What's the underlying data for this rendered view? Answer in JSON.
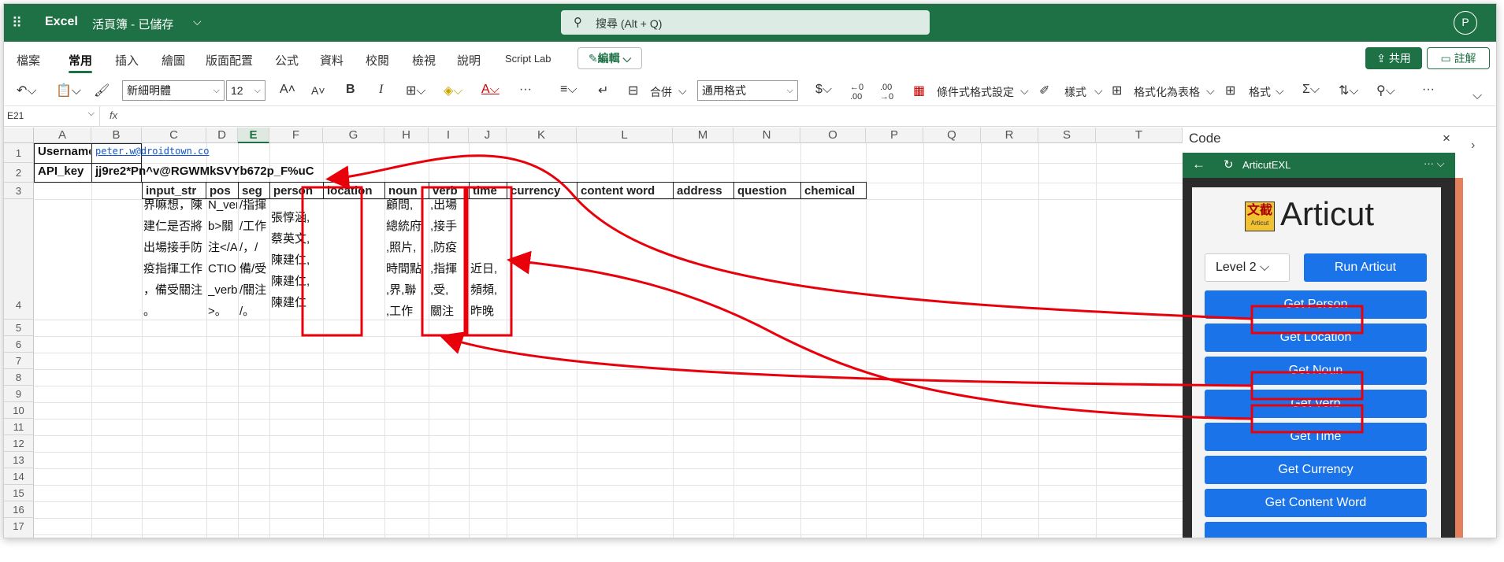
{
  "titlebar": {
    "app": "Excel",
    "doc": "活頁簿 - 已儲存",
    "search": "搜尋 (Alt + Q)",
    "avatar": "P"
  },
  "menus": [
    "檔案",
    "常用",
    "插入",
    "繪圖",
    "版面配置",
    "公式",
    "資料",
    "校閱",
    "檢視",
    "說明",
    "Script Lab"
  ],
  "edit_label": "編輯",
  "share_label": "共用",
  "comment_label": "註解",
  "ribbon": {
    "font": "新細明體",
    "size": "12",
    "format": "通用格式",
    "merge": "合併",
    "cond": "條件式格式設定",
    "styles": "樣式",
    "table": "格式化為表格",
    "fmt": "格式"
  },
  "namebox": "E21",
  "fx": "fx",
  "columns": [
    "A",
    "B",
    "C",
    "D",
    "E",
    "F",
    "G",
    "H",
    "I",
    "J",
    "K",
    "L",
    "M",
    "N",
    "O",
    "P",
    "Q",
    "R",
    "S",
    "T"
  ],
  "selected_col": "E",
  "rows": [
    "1",
    "2",
    "3",
    "4",
    "5",
    "6",
    "7",
    "8",
    "9",
    "10",
    "11",
    "12",
    "13",
    "14",
    "15",
    "16",
    "17"
  ],
  "cells": {
    "a1": "Username",
    "b1": "peter.w@droidtown.co",
    "a2": "API_key",
    "b2": "jj9re2*Pn^v@RGWMkSVYb672p_F%uC",
    "headers": [
      "input_str",
      "pos",
      "seg",
      "person",
      "location",
      "noun",
      "verb",
      "time",
      "currency",
      "content word",
      "address",
      "question",
      "chemical"
    ],
    "c4": "界嘛想，陳\n建仁是否將\n出場接手防\n疫指揮工作\n，備受關注\n。",
    "d4": "N_ver\nb>關\n注</A\nCTION\n_verb\n>。",
    "e4": "/指揮\n/工作\n/，/\n備/受\n/關注\n/。",
    "f4": "張惇涵,\n蔡英文,\n陳建仁,\n陳建仁,\n陳建仁",
    "h4": "顧問,\n總統府\n,照片,\n時間點\n,界,聯\n,工作",
    "i4": ",出場\n,接手\n,防疫\n,指揮\n,受,\n關注",
    "j4": "\n\n\n近日,\n頻頻,\n昨晚"
  },
  "pane": {
    "title": "Code",
    "close": "×",
    "addin_name": "ArticutEXL",
    "app_title": "Articut",
    "logo_main": "文截",
    "logo_sub": "Articut",
    "level": "Level 2",
    "run": "Run Articut",
    "buttons": [
      "Get Person",
      "Get Location",
      "Get Noun",
      "Get Verb",
      "Get Time",
      "Get Currency",
      "Get Content Word"
    ]
  },
  "colors": {
    "excel_green": "#1e7145",
    "button_blue": "#1a73e8",
    "annotation_red": "#e8000b"
  }
}
